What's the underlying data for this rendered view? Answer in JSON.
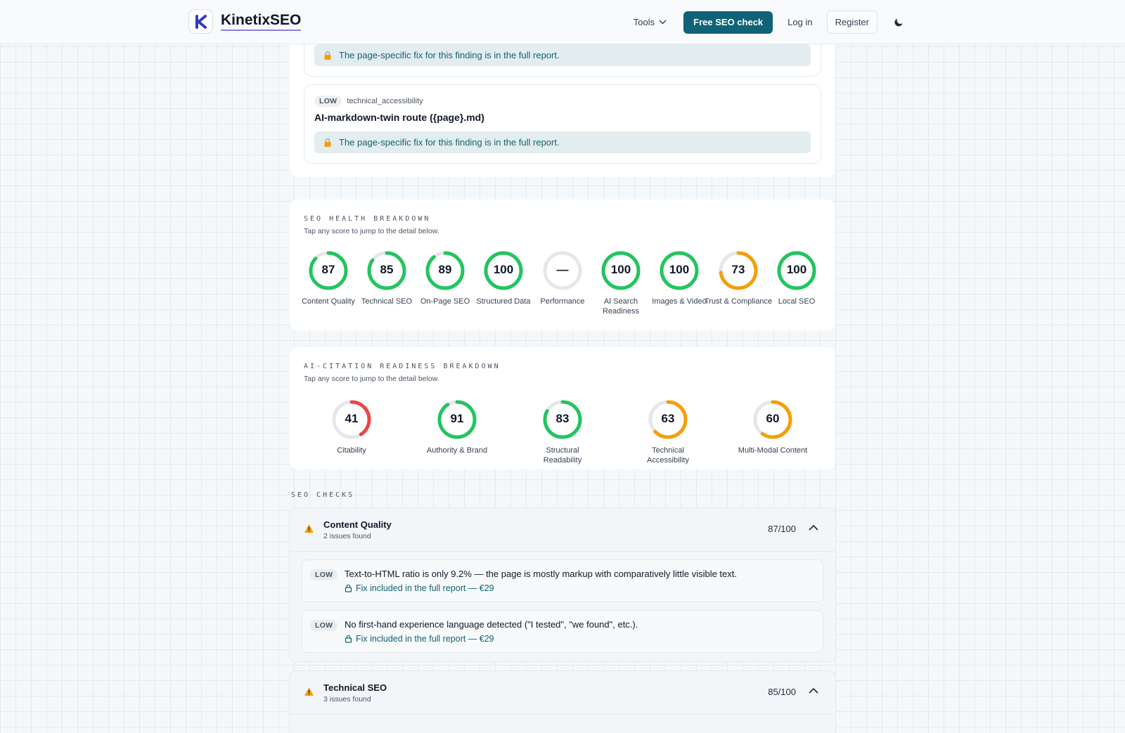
{
  "header": {
    "brand": "KinetixSEO",
    "nav": {
      "tools": "Tools",
      "cta": "Free SEO check",
      "login": "Log in",
      "register": "Register"
    }
  },
  "findings": [
    {
      "fix_note": "The page-specific fix for this finding is in the full report."
    },
    {
      "severity": "LOW",
      "category": "technical_accessibility",
      "title": "AI-markdown-twin route ({page}.md)",
      "fix_note": "The page-specific fix for this finding is in the full report."
    }
  ],
  "seo_health": {
    "heading": "SEO HEALTH BREAKDOWN",
    "subtitle": "Tap any score to jump to the detail below.",
    "scores": [
      {
        "label": "Content Quality",
        "value": "87",
        "pct": 87,
        "color": "#22c55e"
      },
      {
        "label": "Technical SEO",
        "value": "85",
        "pct": 85,
        "color": "#22c55e"
      },
      {
        "label": "On-Page SEO",
        "value": "89",
        "pct": 89,
        "color": "#22c55e"
      },
      {
        "label": "Structured Data",
        "value": "100",
        "pct": 100,
        "color": "#22c55e"
      },
      {
        "label": "Performance",
        "value": "—",
        "pct": 0,
        "color": "#e5e7eb"
      },
      {
        "label": "AI Search Readiness",
        "value": "100",
        "pct": 100,
        "color": "#22c55e"
      },
      {
        "label": "Images & Video",
        "value": "100",
        "pct": 100,
        "color": "#22c55e"
      },
      {
        "label": "Trust & Compliance",
        "value": "73",
        "pct": 73,
        "color": "#f59e0b"
      },
      {
        "label": "Local SEO",
        "value": "100",
        "pct": 100,
        "color": "#22c55e"
      }
    ]
  },
  "ai_citation": {
    "heading": "AI-CITATION READINESS BREAKDOWN",
    "subtitle": "Tap any score to jump to the detail below.",
    "scores": [
      {
        "label": "Citability",
        "value": "41",
        "pct": 41,
        "color": "#ef4444"
      },
      {
        "label": "Authority & Brand",
        "value": "91",
        "pct": 91,
        "color": "#22c55e"
      },
      {
        "label": "Structural Readability",
        "value": "83",
        "pct": 83,
        "color": "#22c55e"
      },
      {
        "label": "Technical Accessibility",
        "value": "63",
        "pct": 63,
        "color": "#f59e0b"
      },
      {
        "label": "Multi-Modal Content",
        "value": "60",
        "pct": 60,
        "color": "#f59e0b"
      }
    ]
  },
  "checks": {
    "heading": "SEO CHECKS",
    "items": [
      {
        "title": "Content Quality",
        "subtitle": "2 issues found",
        "score": "87/100",
        "issues": [
          {
            "severity": "LOW",
            "text": "Text-to-HTML ratio is only 9.2% — the page is mostly markup with comparatively little visible text.",
            "fix": "Fix included in the full report — €29"
          },
          {
            "severity": "LOW",
            "text": "No first-hand experience language detected (\"I tested\", \"we found\", etc.).",
            "fix": "Fix included in the full report — €29"
          }
        ]
      },
      {
        "title": "Technical SEO",
        "subtitle": "3 issues found",
        "score": "85/100"
      }
    ]
  }
}
